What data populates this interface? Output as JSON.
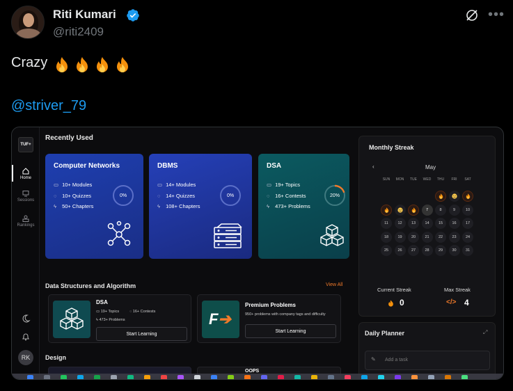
{
  "tweet": {
    "author_name": "Riti Kumari",
    "handle": "@riti2409",
    "text": "Crazy",
    "mention": "@striver_79",
    "accent": "#1d9bf0"
  },
  "app": {
    "logo": "TUF+",
    "nav": [
      {
        "label": "Home",
        "icon": "home-icon"
      },
      {
        "label": "Sessions",
        "icon": "monitor-icon"
      },
      {
        "label": "Rankings",
        "icon": "ranking-icon"
      }
    ],
    "user_initials": "RK",
    "recently_used": {
      "title": "Recently Used",
      "cards": [
        {
          "title": "Computer Networks",
          "l1": "10+ Modules",
          "l2": "10+ Quizzes",
          "l3": "50+ Chapters",
          "progress": "0%",
          "progress_value": 0
        },
        {
          "title": "DBMS",
          "l1": "14+ Modules",
          "l2": "14+ Quizzes",
          "l3": "108+ Chapters",
          "progress": "0%",
          "progress_value": 0
        },
        {
          "title": "DSA",
          "l1": "19+ Topics",
          "l2": "16+ Contests",
          "l3": "473+ Problems",
          "progress": "20%",
          "progress_value": 20
        }
      ]
    },
    "dsa_section": {
      "title": "Data Structures and Algorithm",
      "view_all": "View All",
      "dsa_card": {
        "title": "DSA",
        "topics": "19+ Topics",
        "contests": "16+ Contests",
        "problems": "473+ Problems",
        "button": "Start Learning"
      },
      "premium_card": {
        "title": "Premium Problems",
        "desc": "950+ problems with company tags and difficulty",
        "button": "Start Learning"
      }
    },
    "design_title": "Design",
    "design_peek": "OOPS",
    "streak": {
      "title": "Monthly Streak",
      "month": "May",
      "days_of_week": [
        "SUN",
        "MON",
        "TUE",
        "WED",
        "THU",
        "FRI",
        "SAT"
      ],
      "current_label": "Current Streak",
      "current_value": "0",
      "max_label": "Max Streak",
      "max_value": "4",
      "weeks": [
        [
          "",
          "",
          "",
          "",
          "1",
          "2",
          "3"
        ],
        [
          "4",
          "5",
          "6",
          "7",
          "8",
          "9",
          "10"
        ],
        [
          "11",
          "12",
          "13",
          "14",
          "15",
          "16",
          "17"
        ],
        [
          "18",
          "19",
          "20",
          "21",
          "22",
          "23",
          "24"
        ],
        [
          "25",
          "26",
          "27",
          "28",
          "29",
          "30",
          "31"
        ]
      ],
      "fire_days": [
        "1",
        "3",
        "4",
        "6"
      ],
      "sad_days": [
        "2",
        "5"
      ],
      "today": "7"
    },
    "planner": {
      "title": "Daily Planner",
      "placeholder": "Add a task"
    }
  }
}
